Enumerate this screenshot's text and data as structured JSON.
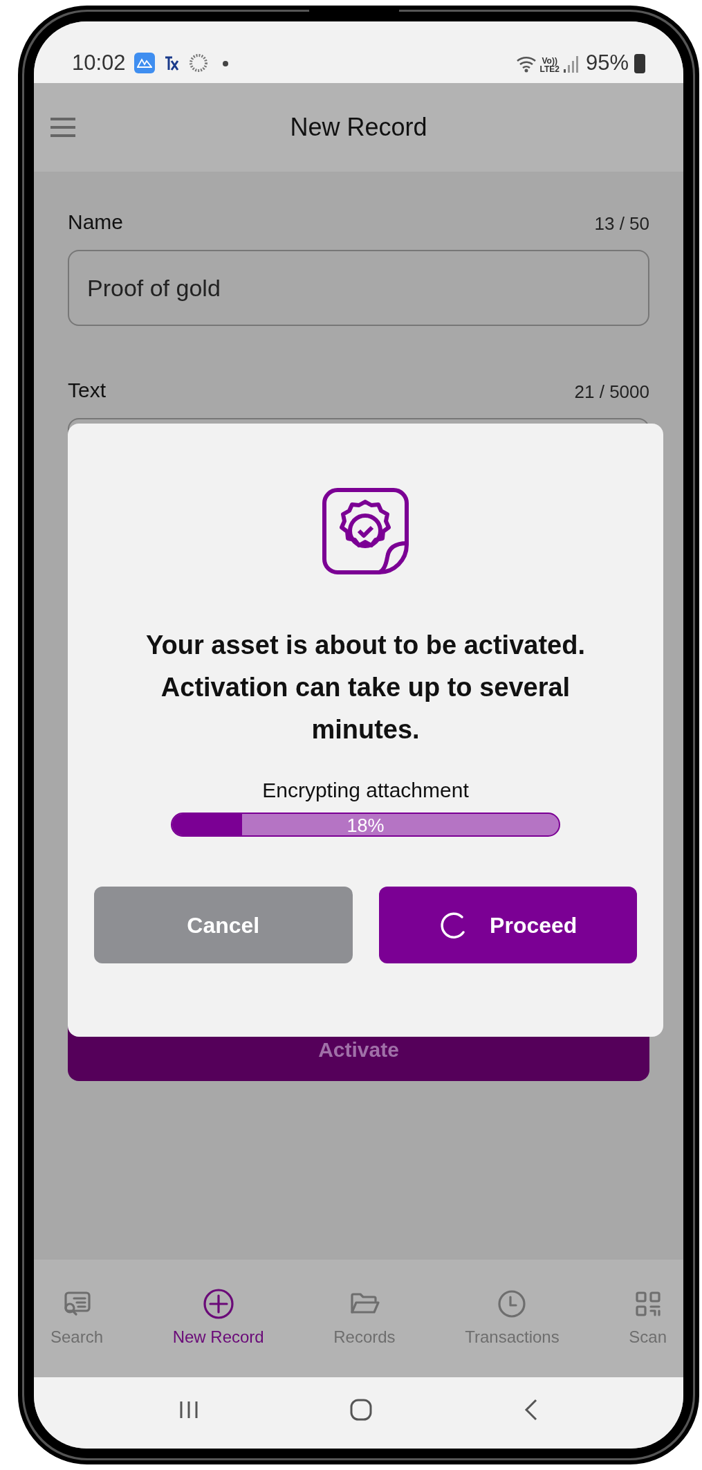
{
  "status_bar": {
    "time": "10:02",
    "volte": "Vo))",
    "network": "LTE2",
    "battery": "95%"
  },
  "app_bar": {
    "title": "New Record"
  },
  "form": {
    "fields": [
      {
        "label": "Name",
        "counter": "13 / 50",
        "value": "Proof of gold"
      },
      {
        "label": "Text",
        "counter": "21 / 5000"
      }
    ],
    "activate_button": "Activate"
  },
  "dialog": {
    "message": "Your asset is about to be activated. Activation can take up to several minutes.",
    "progress": {
      "label": "Encrypting attachment",
      "level": 0.18,
      "reading": "18%"
    },
    "buttons": [
      {
        "label": "Cancel",
        "kind": "secondary",
        "busy": false
      },
      {
        "label": "Proceed",
        "kind": "primary",
        "busy": true
      }
    ]
  },
  "bottom_nav": [
    {
      "label": "Search",
      "kind": "search",
      "selected": false
    },
    {
      "label": "New Record",
      "kind": "add",
      "selected": true
    },
    {
      "label": "Records",
      "kind": "folder",
      "selected": false
    },
    {
      "label": "Transactions",
      "kind": "clock",
      "selected": false
    },
    {
      "label": "Scan",
      "kind": "qr",
      "selected": false
    }
  ]
}
